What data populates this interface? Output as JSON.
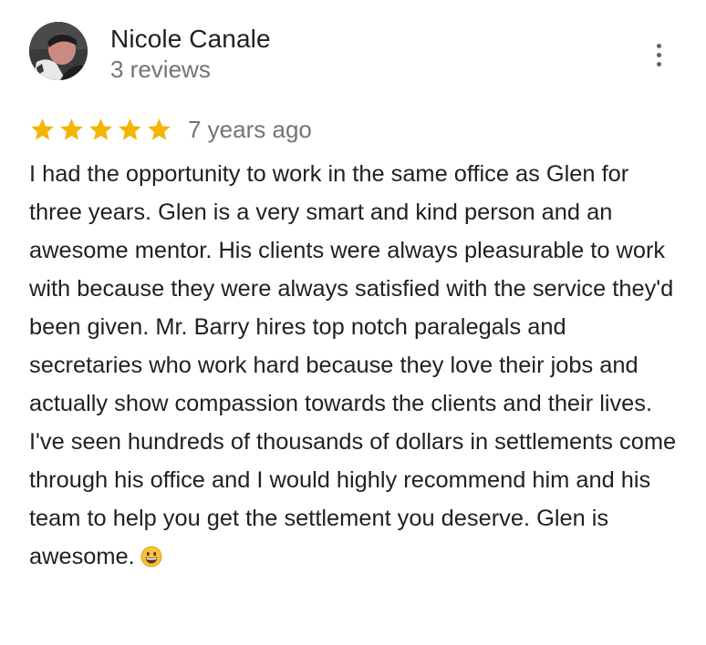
{
  "review": {
    "reviewer_name": "Nicole Canale",
    "review_count": "3 reviews",
    "rating": 5,
    "rating_max": 5,
    "date": "7 years ago",
    "text": "I had the opportunity to work in the same office as Glen for three years. Glen is a very smart and kind person and an awesome mentor. His clients were always pleasurable to work with because they were always satisfied with the service they'd been given. Mr. Barry hires top notch paralegals and secretaries who work hard because they love their jobs and actually show compassion towards the clients and their lives. I've seen hundreds of thousands of dollars in settlements come through his office and I would highly recommend him and his team to help you get the settlement you deserve. Glen is awesome.",
    "emoji": "grinning-face-emoji"
  },
  "icons": {
    "avatar": "profile-photo",
    "more": "more-vert-icon",
    "star": "star-icon"
  },
  "colors": {
    "star": "#f4b400",
    "name": "#212121",
    "secondary": "#70757a",
    "body_text": "#202124"
  }
}
